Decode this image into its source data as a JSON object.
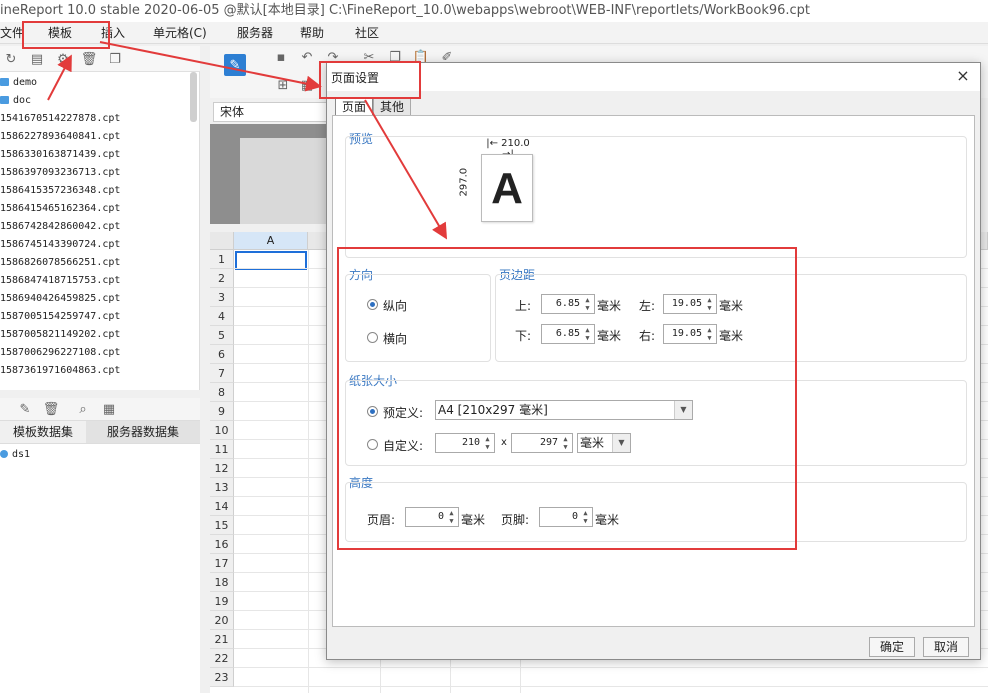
{
  "window": {
    "title": "ineReport 10.0 stable 2020-06-05 @默认[本地目录]    C:\\FineReport_10.0\\webapps\\webroot\\WEB-INF\\reportlets/WorkBook96.cpt"
  },
  "menu": {
    "items": [
      "文件",
      "模板",
      "插入",
      "单元格(C)",
      "服务器",
      "帮助",
      "社区"
    ]
  },
  "filetree": {
    "folders": [
      "demo",
      "doc"
    ],
    "files": [
      "1541670514227878.cpt",
      "1586227893640841.cpt",
      "1586330163871439.cpt",
      "1586397093236713.cpt",
      "1586415357236348.cpt",
      "1586415465162364.cpt",
      "1586742842860042.cpt",
      "1586745143390724.cpt",
      "1586826078566251.cpt",
      "1586847418715753.cpt",
      "1586940426459825.cpt",
      "1587005154259747.cpt",
      "1587005821149202.cpt",
      "1587006296227108.cpt",
      "1587361971604863.cpt"
    ]
  },
  "datasets": {
    "tabs": [
      "模板数据集",
      "服务器数据集"
    ],
    "items": [
      "ds1"
    ]
  },
  "toolbar": {
    "font": "宋体"
  },
  "sheet": {
    "column": "A",
    "rows": [
      "1",
      "2",
      "3",
      "4",
      "5",
      "6",
      "7",
      "8",
      "9",
      "10",
      "11",
      "12",
      "13",
      "14",
      "15",
      "16",
      "17",
      "18",
      "19",
      "20",
      "21",
      "22",
      "23"
    ]
  },
  "dialog": {
    "title": "页面设置",
    "close": "×",
    "tabs": [
      "页面",
      "其他"
    ],
    "preview": {
      "label": "预览",
      "width": "210.0",
      "height": "297.0",
      "letter": "A"
    },
    "orientation": {
      "label": "方向",
      "portrait": "纵向",
      "landscape": "横向",
      "selected": "portrait"
    },
    "margins": {
      "label": "页边距",
      "top_label": "上:",
      "top": "6.85",
      "bottom_label": "下:",
      "bottom": "6.85",
      "left_label": "左:",
      "left": "19.05",
      "right_label": "右:",
      "right": "19.05",
      "unit": "毫米"
    },
    "paper": {
      "label": "纸张大小",
      "preset_label": "预定义:",
      "preset_value": "A4 [210x297 毫米]",
      "custom_label": "自定义:",
      "custom_width": "210",
      "times": "x",
      "custom_height": "297",
      "custom_unit": "毫米"
    },
    "height": {
      "label": "高度",
      "header_label": "页眉:",
      "header": "0",
      "footer_label": "页脚:",
      "footer": "0",
      "unit": "毫米"
    },
    "ok": "确定",
    "cancel": "取消"
  },
  "colors": {
    "annotation": "#e23b3b",
    "accent": "#3a78c2"
  }
}
